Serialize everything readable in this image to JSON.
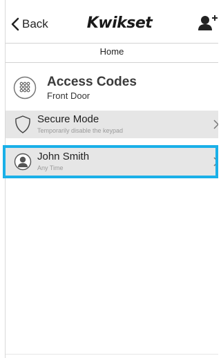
{
  "nav": {
    "back_label": "Back",
    "brand": "Kwikset"
  },
  "subheader": {
    "title": "Home"
  },
  "access_codes": {
    "title": "Access Codes",
    "subtitle": "Front Door"
  },
  "rows": [
    {
      "title": "Secure Mode",
      "subtitle": "Temporarily disable the keypad",
      "icon": "shield-icon"
    },
    {
      "title": "John Smith",
      "subtitle": "Any Time",
      "icon": "user-avatar-icon"
    }
  ],
  "colors": {
    "highlight": "#1ab0e8",
    "row_bg": "#e6e6e6"
  }
}
